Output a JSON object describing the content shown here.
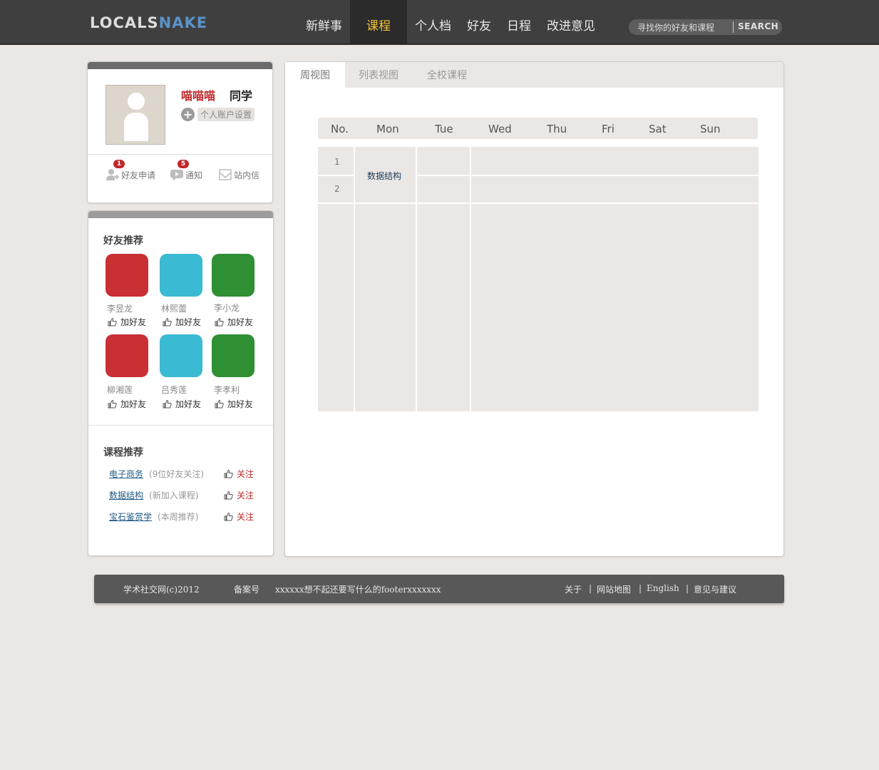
{
  "header": {
    "logo_part1": "LOCALS",
    "logo_part2": "NAKE",
    "nav": [
      "新鲜事",
      "课程",
      "个人档",
      "好友",
      "日程",
      "改进意见"
    ],
    "search_placeholder": "寻找你的好友和课程",
    "search_button": "SEARCH",
    "colors": {
      "bar": "#3f3f3f",
      "active_text": "#f0c23a",
      "logo_accent": "#5a93c9"
    }
  },
  "profile": {
    "name": "喵喵喵",
    "role": "同学",
    "settings_label": "个人账户设置",
    "actions": [
      {
        "label": "好友申请",
        "badge": "1",
        "icon": "add-friend-icon"
      },
      {
        "label": "通知",
        "badge": "5",
        "icon": "notification-icon"
      },
      {
        "label": "站内信",
        "icon": "message-icon"
      }
    ]
  },
  "friends": {
    "title": "好友推荐",
    "add_label": "加好友",
    "items": [
      {
        "name": "李昱龙",
        "color": "#c93033"
      },
      {
        "name": "林熙蕾",
        "color": "#3bbad3"
      },
      {
        "name": "李小龙",
        "color": "#2e8f33"
      },
      {
        "name": "柳湘莲",
        "color": "#c93033"
      },
      {
        "name": "吕秀莲",
        "color": "#3bbad3"
      },
      {
        "name": "李孝利",
        "color": "#2e8f33"
      }
    ]
  },
  "courses": {
    "title": "课程推荐",
    "follow_label": "关注",
    "items": [
      {
        "name": "电子商务",
        "note": "(9位好友关注)"
      },
      {
        "name": "数据结构",
        "note": "(新加入课程)"
      },
      {
        "name": "宝石鉴赏学",
        "note": "(本周推荐)"
      }
    ]
  },
  "tabs": [
    "周视图",
    "列表视图",
    "全校课程"
  ],
  "schedule": {
    "headers": [
      "No.",
      "Mon",
      "Tue",
      "Wed",
      "Thu",
      "Fri",
      "Sat",
      "Sun"
    ],
    "rows": [
      "1",
      "2"
    ],
    "course": "数据结构"
  },
  "footer": {
    "copyright": "学术社交网(c)2012",
    "icp": "备案号",
    "text": "xxxxxx想不起还要写什么的footerxxxxxxx",
    "links": [
      "关于",
      "网站地图",
      "English",
      "意见与建议"
    ]
  }
}
